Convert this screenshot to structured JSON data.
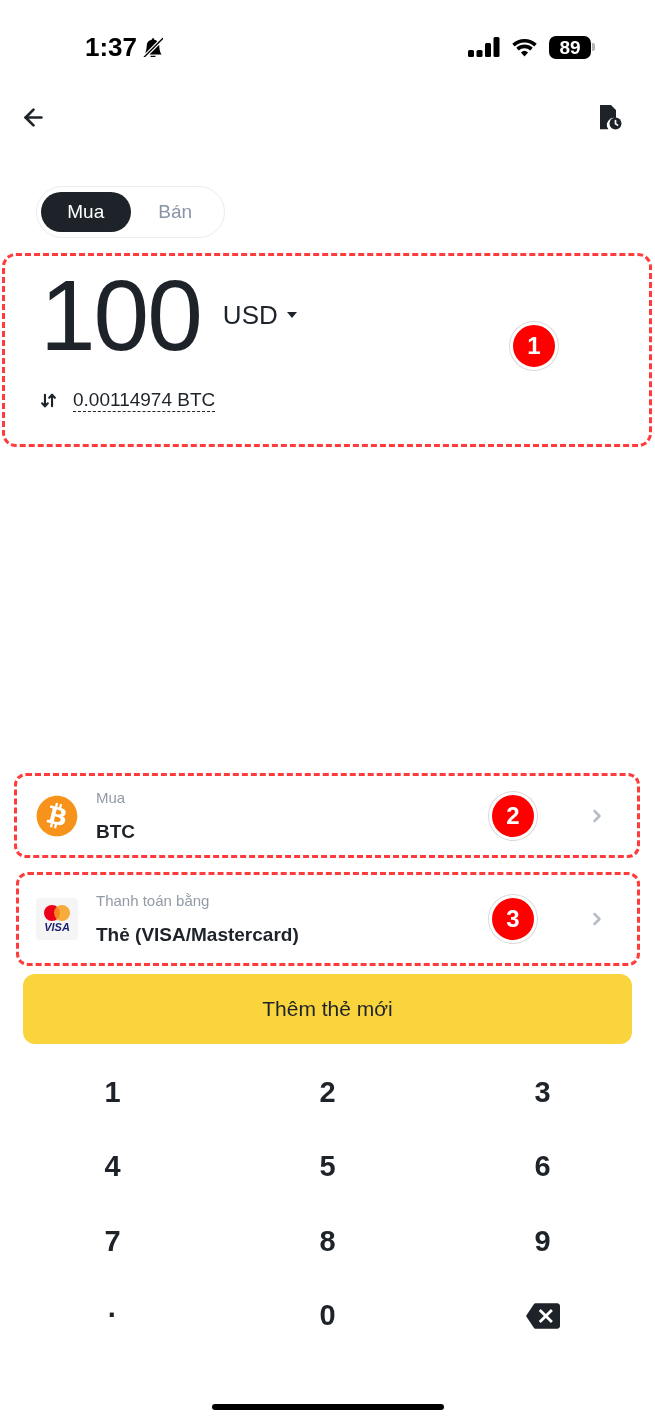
{
  "status_bar": {
    "time": "1:37",
    "battery": "89"
  },
  "tabs": [
    {
      "label": "Mua",
      "selected": true
    },
    {
      "label": "Bán",
      "selected": false
    }
  ],
  "amount": {
    "callout": "1",
    "value": "100",
    "currency": "USD",
    "converted": "0.00114974 BTC"
  },
  "selectors": [
    {
      "kind": "coin",
      "callout": "2",
      "label": "Mua",
      "value": "BTC"
    },
    {
      "kind": "card",
      "callout": "3",
      "label": "Thanh toán bằng",
      "value": "Thẻ (VISA/Mastercard)",
      "logo_text": "VISA"
    }
  ],
  "primary_button": "Thêm thẻ mới",
  "keypad": [
    {
      "kind": "text",
      "label": "1"
    },
    {
      "kind": "text",
      "label": "2"
    },
    {
      "kind": "text",
      "label": "3"
    },
    {
      "kind": "text",
      "label": "4"
    },
    {
      "kind": "text",
      "label": "5"
    },
    {
      "kind": "text",
      "label": "6"
    },
    {
      "kind": "text",
      "label": "7"
    },
    {
      "kind": "text",
      "label": "8"
    },
    {
      "kind": "text",
      "label": "9"
    },
    {
      "kind": "text",
      "label": "·"
    },
    {
      "kind": "text",
      "label": "0"
    },
    {
      "kind": "backspace"
    }
  ]
}
